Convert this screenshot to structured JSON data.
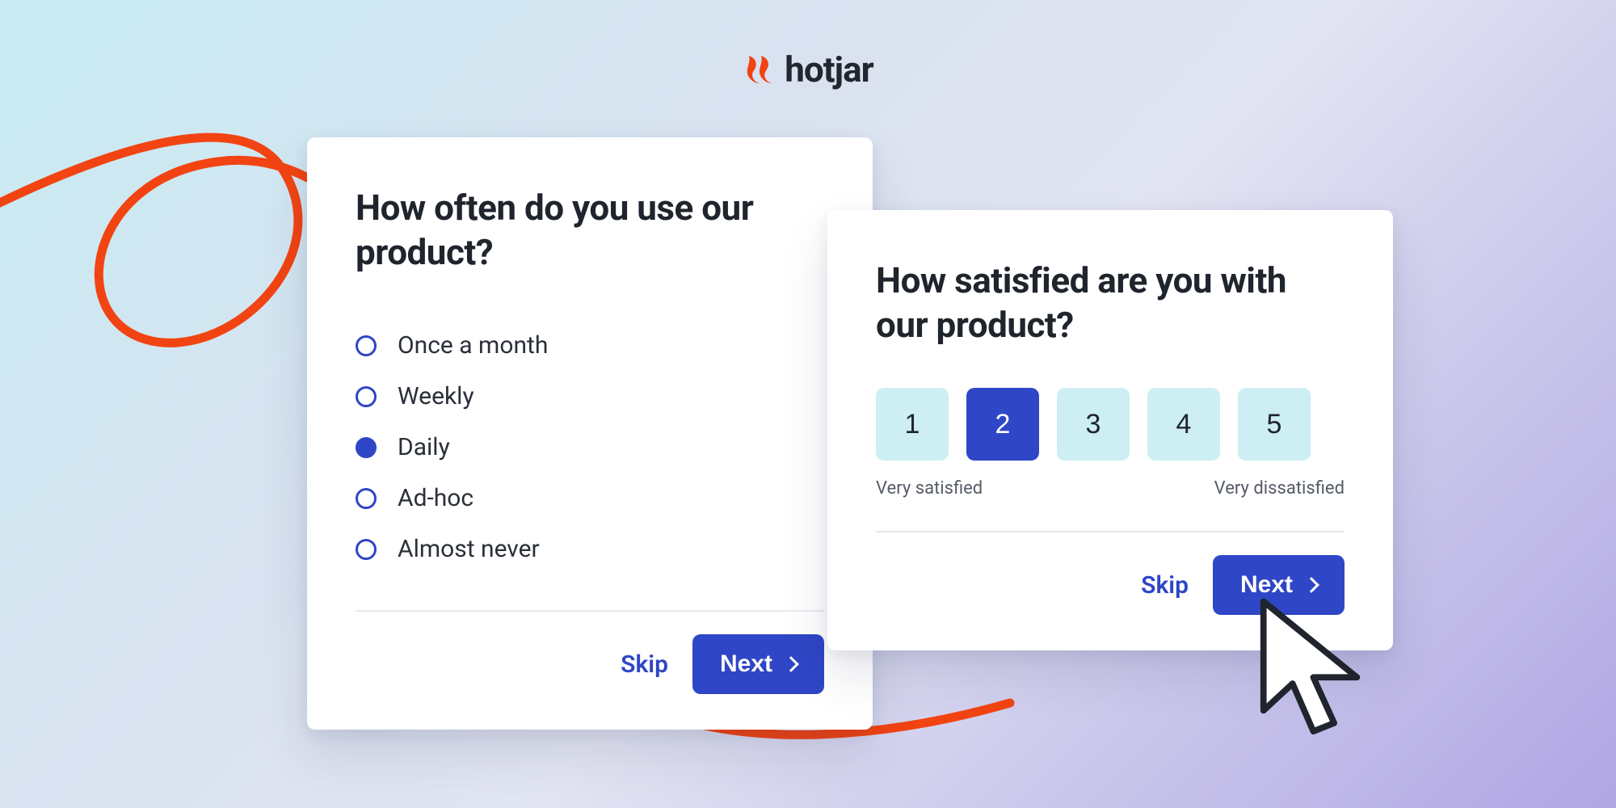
{
  "brand": {
    "name": "hotjar"
  },
  "colors": {
    "accent": "#2f46c6",
    "logo": "#f24412",
    "rating_bg": "#cdeef3"
  },
  "card_a": {
    "question": "How often do you use our product?",
    "options": [
      {
        "label": "Once a month",
        "selected": false
      },
      {
        "label": "Weekly",
        "selected": false
      },
      {
        "label": "Daily",
        "selected": true
      },
      {
        "label": "Ad-hoc",
        "selected": false
      },
      {
        "label": "Almost never",
        "selected": false
      }
    ],
    "skip_label": "Skip",
    "next_label": "Next"
  },
  "card_b": {
    "question": "How satisfied are you with our product?",
    "ratings": [
      {
        "value": "1",
        "selected": false
      },
      {
        "value": "2",
        "selected": true
      },
      {
        "value": "3",
        "selected": false
      },
      {
        "value": "4",
        "selected": false
      },
      {
        "value": "5",
        "selected": false
      }
    ],
    "low_label": "Very satisfied",
    "high_label": "Very dissatisfied",
    "skip_label": "Skip",
    "next_label": "Next"
  }
}
